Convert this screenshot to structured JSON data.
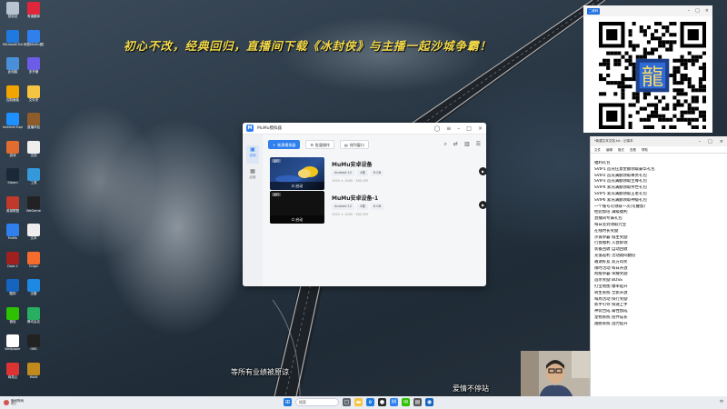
{
  "desktop": {
    "banner": "初心不改，经典回归，直播间下载《冰封侠》与主播一起沙城争霸！",
    "icons": [
      {
        "label": "回收站",
        "icon": "recycle-bin-icon",
        "color": "#b8c4cf"
      },
      {
        "label": "有道翻译",
        "icon": "youdao-icon",
        "color": "#e0263a"
      },
      {
        "label": "Microsoft Edge",
        "icon": "edge-icon",
        "color": "#1f7ae0"
      },
      {
        "label": "网易MuMu模拟器",
        "icon": "mumu-icon",
        "color": "#2f80ed"
      },
      {
        "label": "此电脑",
        "icon": "computer-icon",
        "color": "#4a90d9"
      },
      {
        "label": "多开器",
        "icon": "multi-icon",
        "color": "#6c5ce7"
      },
      {
        "label": "控制面板",
        "icon": "control-panel-icon",
        "color": "#f0a500"
      },
      {
        "label": "文件夹",
        "icon": "folder-icon",
        "color": "#f5c542"
      },
      {
        "label": "Internet Explorer",
        "icon": "ie-icon",
        "color": "#1e90ff"
      },
      {
        "label": "直播伴侣",
        "icon": "avatar-app-icon",
        "color": "#8e5b2b"
      },
      {
        "label": "游戏",
        "icon": "game-icon",
        "color": "#e06c2f"
      },
      {
        "label": "文档",
        "icon": "document-icon",
        "color": "#eeeeee"
      },
      {
        "label": "Steam",
        "icon": "steam-icon",
        "color": "#1b2838"
      },
      {
        "label": "工具",
        "icon": "tool-icon",
        "color": "#3498db"
      },
      {
        "label": "英雄联盟",
        "icon": "lol-icon",
        "color": "#c0392b"
      },
      {
        "label": "WeGame",
        "icon": "wegame-icon",
        "color": "#222222"
      },
      {
        "label": "MuMu",
        "icon": "mumu2-icon",
        "color": "#2f80ed"
      },
      {
        "label": "文本",
        "icon": "text-icon",
        "color": "#eeeeee"
      },
      {
        "label": "Dota 2",
        "icon": "dota-icon",
        "color": "#a02020"
      },
      {
        "label": "Origin",
        "icon": "origin-icon",
        "color": "#f56c2d"
      },
      {
        "label": "酷狗",
        "icon": "kugou-icon",
        "color": "#1565c0"
      },
      {
        "label": "迅雷",
        "icon": "xunlei-icon",
        "color": "#1e88e5"
      },
      {
        "label": "微信",
        "icon": "wechat-icon",
        "color": "#2dc100"
      },
      {
        "label": "腾讯会议",
        "icon": "meeting-icon",
        "color": "#27ae60"
      },
      {
        "label": "Wallpaper",
        "icon": "wallpaper-icon",
        "color": "#ffffff"
      },
      {
        "label": "OBS",
        "icon": "obs-icon",
        "color": "#222222"
      },
      {
        "label": "网易云",
        "icon": "music-icon",
        "color": "#d33"
      },
      {
        "label": "WoW",
        "icon": "wow-icon",
        "color": "#c08a1c"
      }
    ]
  },
  "mumu": {
    "title": "MuMu模拟器",
    "sidebar": [
      {
        "label": "实例",
        "active": true
      },
      {
        "label": "应用",
        "active": false
      }
    ],
    "toolbar": {
      "new_label": "新建模拟器",
      "btn2_label": "批量操作",
      "btn3_label": "排列窗口"
    },
    "instances": [
      {
        "name": "MuMu安卓设备",
        "tag1": "Android 12",
        "tag2": "4核",
        "tag3": "8 GB",
        "res": "1920 × 1080 · 280 DPI",
        "badge": "运行",
        "start": "启动"
      },
      {
        "name": "MuMu安卓设备-1",
        "tag1": "Android 12",
        "tag2": "4核",
        "tag3": "8 GB",
        "res": "1920 × 1080 · 280 DPI",
        "badge": "运行",
        "start": "启动"
      }
    ]
  },
  "qr": {
    "chip": "二维码"
  },
  "notepad": {
    "title": "*新建文本文档.txt - 记事本",
    "menu": [
      "文件",
      "编辑",
      "格式",
      "查看",
      "帮助"
    ],
    "lines": [
      "福利礼包",
      "SVIP1     首充任意金额领取豪华礼包",
      "SVIP2     首充满额领取尊贵礼包",
      "SVIP3     首充满额领取至尊礼包",
      "SVIP4     累充满额领取传世礼包",
      "SVIP5     累充满额领取王者礼包",
      "SVIP6     累充满额领取神级礼包",
      "一个账号可领取一次(可叠加)",
      "经验加倍 满级福利",
      "直播间专属礼包",
      "每日签到领取元宝",
      "在线时长奖励",
      "沙城争霸 城主奖励",
      "行会福利 入会即领",
      "装备回收 自动回收",
      "充值返利 活动期间翻倍",
      "邀请好友 双方得奖",
      "限时活动 每日开放",
      "跨服争霸 荣耀奖励",
      "首杀奖励 BOSS",
      "打宝地图 爆率提升",
      "转生系统 全新开放",
      "每周活动 排行奖励",
      "新手引导 快速上手",
      "神装合成 属性加成",
      "宠物系统 陪伴成长",
      "翅膀系统 战力提升"
    ]
  },
  "subtitles": {
    "left": "等所有业绩被原谅",
    "right": "爱情不停站"
  },
  "taskbar": {
    "weather_title": "晚间阵雨",
    "weather_sub": "明天",
    "search": "搜索",
    "tray": "中"
  }
}
